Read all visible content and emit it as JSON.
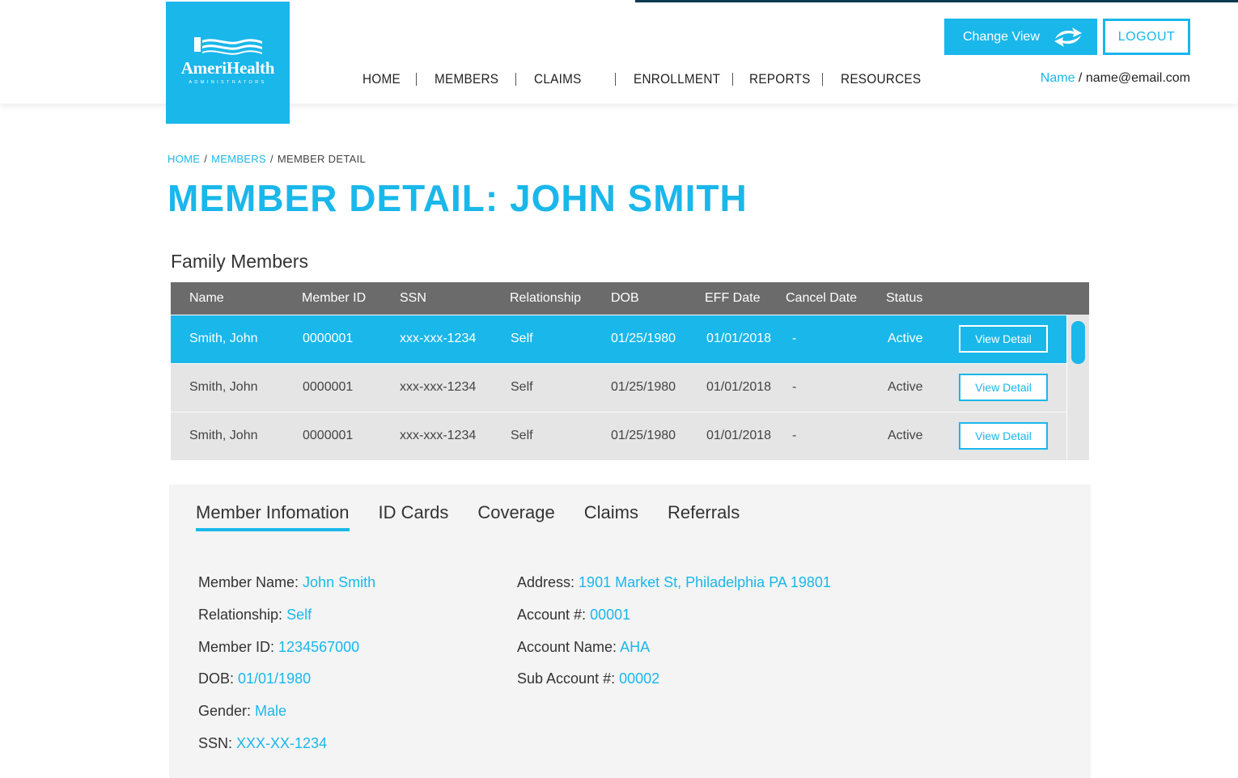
{
  "header": {
    "logo": {
      "name": "AmeriHealth",
      "sub": "ADMINISTRATORS"
    },
    "nav": [
      "HOME",
      "MEMBERS",
      "CLAIMS",
      "ENROLLMENT",
      "REPORTS",
      "RESOURCES"
    ],
    "change_view": "Change View",
    "logout": "LOGOUT",
    "user_name": "Name",
    "user_separator": " / ",
    "user_email": "name@email.com"
  },
  "breadcrumb": {
    "home": "HOME",
    "members": "MEMBERS",
    "current": "MEMBER DETAIL",
    "separator": "/"
  },
  "page_title": "MEMBER DETAIL: JOHN SMITH",
  "family": {
    "title": "Family Members",
    "columns": [
      "Name",
      "Member ID",
      "SSN",
      "Relationship",
      "DOB",
      "EFF Date",
      "Cancel Date",
      "Status"
    ],
    "rows": [
      {
        "name": "Smith, John",
        "member_id": "0000001",
        "ssn": "xxx-xxx-1234",
        "relationship": "Self",
        "dob": "01/25/1980",
        "eff_date": "01/01/2018",
        "cancel_date": "-",
        "status": "Active",
        "button": "View Detail",
        "selected": true
      },
      {
        "name": "Smith, John",
        "member_id": "0000001",
        "ssn": "xxx-xxx-1234",
        "relationship": "Self",
        "dob": "01/25/1980",
        "eff_date": "01/01/2018",
        "cancel_date": "-",
        "status": "Active",
        "button": "View Detail",
        "selected": false
      },
      {
        "name": "Smith, John",
        "member_id": "0000001",
        "ssn": "xxx-xxx-1234",
        "relationship": "Self",
        "dob": "01/25/1980",
        "eff_date": "01/01/2018",
        "cancel_date": "-",
        "status": "Active",
        "button": "View Detail",
        "selected": false
      }
    ]
  },
  "tabs": [
    "Member Infomation",
    "ID Cards",
    "Coverage",
    "Claims",
    "Referrals"
  ],
  "active_tab": "Member Infomation",
  "member_info": {
    "left": [
      {
        "label": "Member Name: ",
        "value": "John Smith"
      },
      {
        "label": "Relationship: ",
        "value": "Self"
      },
      {
        "label": "Member ID: ",
        "value": "1234567000"
      },
      {
        "label": "DOB: ",
        "value": "01/01/1980"
      },
      {
        "label": "Gender: ",
        "value": "Male"
      },
      {
        "label": "SSN: ",
        "value": "XXX-XX-1234"
      }
    ],
    "right": [
      {
        "label": "Address: ",
        "value": "1901 Market St, Philadelphia PA 19801"
      },
      {
        "label": "Account #: ",
        "value": "00001"
      },
      {
        "label": "Account Name: ",
        "value": "AHA"
      },
      {
        "label": "Sub Account #: ",
        "value": "00002"
      }
    ]
  },
  "colors": {
    "accent": "#1ab7ea",
    "table_header": "#6b6b6b",
    "row_bg": "#e5e5e5",
    "panel_bg": "#f4f4f4"
  },
  "icons": {
    "change_view": "swap-arrows-icon"
  }
}
